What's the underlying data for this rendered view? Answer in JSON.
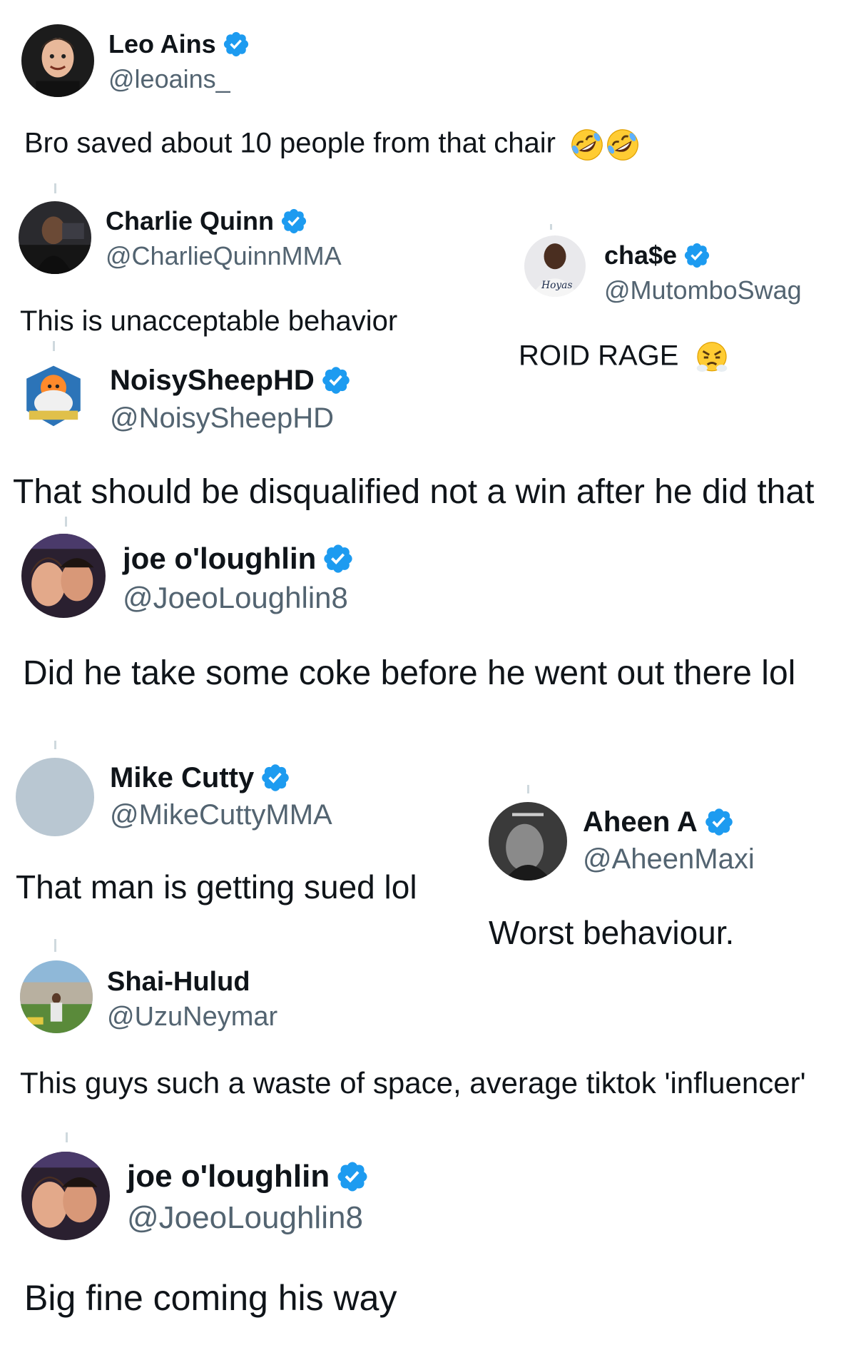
{
  "replies": [
    {
      "name": "Leo Ains",
      "handle": "@leoains_",
      "verified": true,
      "text": "Bro saved about 10 people from that chair",
      "emoji": "rolling-on-floor-laughing x2"
    },
    {
      "name": "Charlie Quinn",
      "handle": "@CharlieQuinnMMA",
      "verified": true,
      "text": "This is unacceptable behavior"
    },
    {
      "name": "cha$e",
      "handle": "@MutomboSwag",
      "verified": true,
      "text": "ROID RAGE",
      "emoji": "face-with-steam-from-nose"
    },
    {
      "name": "NoisySheepHD",
      "handle": "@NoisySheepHD",
      "verified": true,
      "text": "That should be disqualified not a win after he did that"
    },
    {
      "name": "joe o'loughlin",
      "handle": "@JoeoLoughlin8",
      "verified": true,
      "text": "Did he take some coke before he went out there lol"
    },
    {
      "name": "Mike Cutty",
      "handle": "@MikeCuttyMMA",
      "verified": true,
      "text": "That man is getting sued lol"
    },
    {
      "name": "Aheen A",
      "handle": "@AheenMaxi",
      "verified": true,
      "text": "Worst behaviour."
    },
    {
      "name": "Shai-Hulud",
      "handle": "@UzuNeymar",
      "verified": false,
      "text": "This guys such a waste of space, average tiktok 'influencer'"
    },
    {
      "name": "joe o'loughlin",
      "handle": "@JoeoLoughlin8",
      "verified": true,
      "text": "Big fine coming his way"
    }
  ],
  "colors": {
    "verified_badge": "#1d9bf0",
    "handle": "#536471",
    "text": "#0f1419",
    "placeholder_avatar": "#b9c7d2"
  },
  "icons": [
    "verified-badge-icon",
    "rolling-on-floor-laughing-emoji",
    "face-with-steam-from-nose-emoji"
  ]
}
